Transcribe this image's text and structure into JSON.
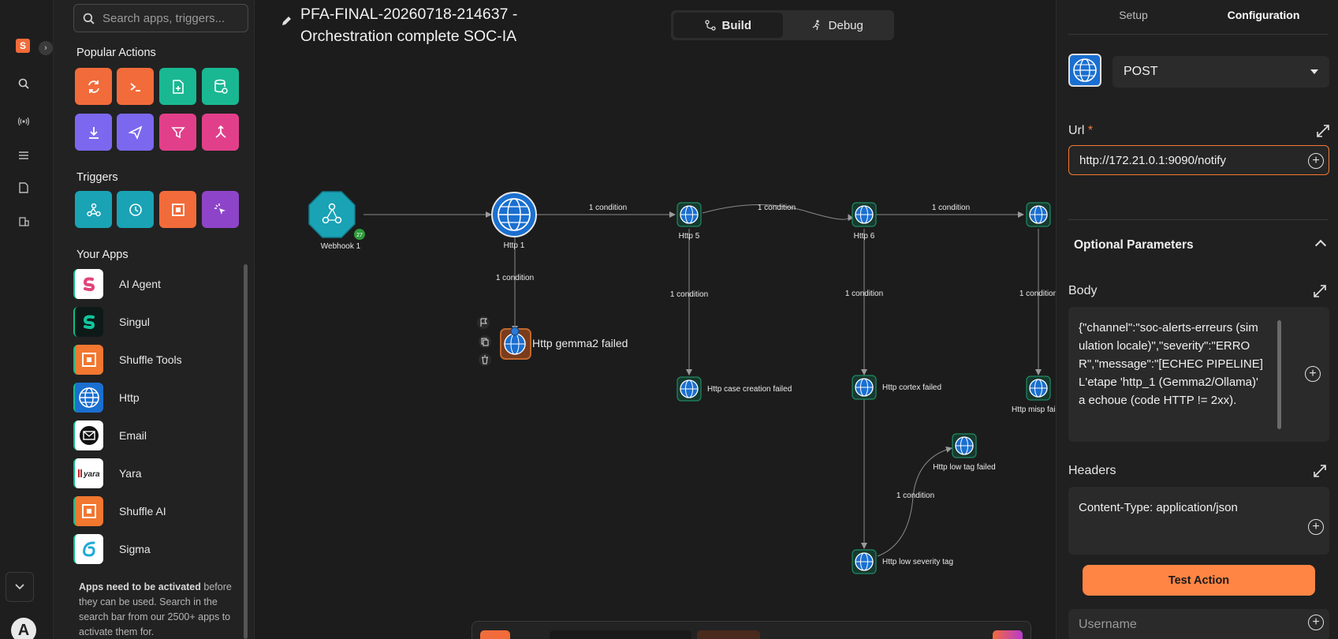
{
  "left_panel": {
    "search_placeholder": "Search apps, triggers...",
    "popular_actions_title": "Popular Actions",
    "triggers_title": "Triggers",
    "your_apps_title": "Your Apps",
    "apps": [
      {
        "label": "AI Agent",
        "icon": "ai-agent-logo"
      },
      {
        "label": "Singul",
        "icon": "singul-logo"
      },
      {
        "label": "Shuffle Tools",
        "icon": "shuffle-tools-logo"
      },
      {
        "label": "Http",
        "icon": "globe-icon"
      },
      {
        "label": "Email",
        "icon": "email-icon"
      },
      {
        "label": "Yara",
        "icon": "yara-logo"
      },
      {
        "label": "Shuffle AI",
        "icon": "shuffle-ai-logo"
      },
      {
        "label": "Sigma",
        "icon": "sigma-logo"
      }
    ],
    "note_bold": "Apps need to be activated",
    "note_rest": " before they can be used. Search in the search bar from our 2500+ apps to activate them for."
  },
  "workflow": {
    "title": "PFA-FINAL-20260718-214637 - Orchestration complete SOC-IA",
    "mode_build": "Build",
    "mode_debug": "Debug",
    "nodes": {
      "webhook": "Webhook 1",
      "http1": "Http 1",
      "http5": "Http 5",
      "http6": "Http 6",
      "gemma_failed": "Http gemma2 failed",
      "case_failed": "Http case creation failed",
      "cortex_failed": "Http cortex failed",
      "misp_failed": "Http misp fail",
      "low_tag_failed": "Http low tag failed",
      "low_severity": "Http low severity tag"
    },
    "edge_label": "1 condition",
    "trigger_badge": "27"
  },
  "right_panel": {
    "tab_setup": "Setup",
    "tab_configuration": "Configuration",
    "method": "POST",
    "url_label": "Url",
    "url_required": "*",
    "url_value": "http://172.21.0.1:9090/notify",
    "optional_title": "Optional Parameters",
    "body_label": "Body",
    "body_value": "{\"channel\":\"soc-alerts-erreurs (simulation locale)\",\"severity\":\"ERROR\",\"message\":\"[ECHEC PIPELINE] L'etape 'http_1 (Gemma2/Ollama)' a echoue (code HTTP != 2xx).",
    "headers_label": "Headers",
    "headers_value": "Content-Type: application/json",
    "test_button": "Test Action",
    "username_placeholder": "Username"
  },
  "colors": {
    "accent_orange": "#f47a33",
    "node_teal": "#1aa3b5",
    "node_blue": "#1a6fd0",
    "success_green": "#0ebd8b"
  }
}
